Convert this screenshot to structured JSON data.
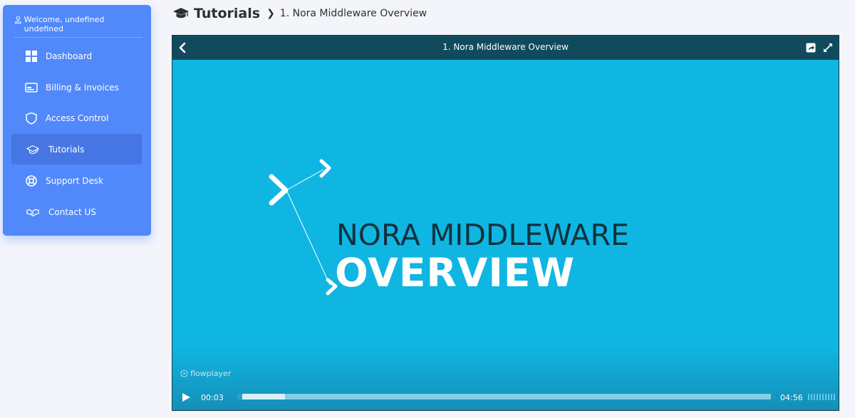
{
  "sidebar": {
    "welcome": "Welcome, undefined undefined",
    "items": [
      {
        "label": "Dashboard",
        "icon": "grid-icon"
      },
      {
        "label": "Billing & Invoices",
        "icon": "card-icon"
      },
      {
        "label": "Access Control",
        "icon": "shield-icon"
      },
      {
        "label": "Tutorials",
        "icon": "graduation-cap-icon",
        "active": true
      },
      {
        "label": "Support Desk",
        "icon": "lifebuoy-icon"
      },
      {
        "label": "Contact US",
        "icon": "handshake-icon"
      }
    ]
  },
  "breadcrumb": {
    "title": "Tutorials",
    "current": "1. Nora Middleware Overview"
  },
  "player": {
    "title": "1. Nora Middleware Overview",
    "art_line1": "NORA MIDDLEWARE",
    "art_line2": "OVERVIEW",
    "brand": "flowplayer",
    "elapsed": "00:03",
    "duration": "04:56",
    "progress_fraction": 0.01,
    "buffered_fraction": 0.09
  },
  "colors": {
    "sidebar": "#5189fb",
    "sidebar_active": "#4576e3",
    "video_bg": "#0fb6e2",
    "topbar": "#114a5c"
  }
}
